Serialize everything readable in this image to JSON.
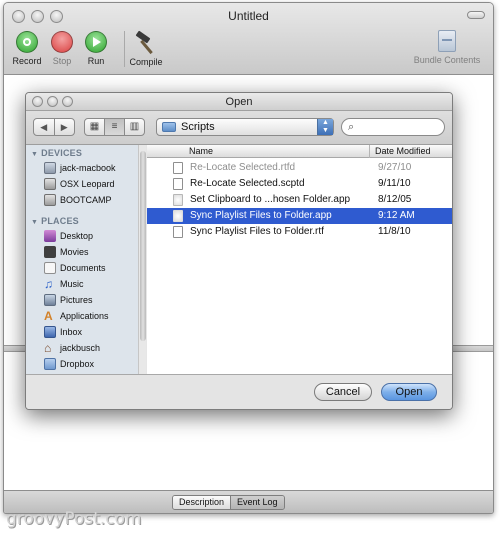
{
  "window": {
    "title": "Untitled"
  },
  "toolbar": {
    "record": "Record",
    "stop": "Stop",
    "run": "Run",
    "compile": "Compile",
    "bundle_contents": "Bundle Contents"
  },
  "bottom_tabs": [
    "Description",
    "Event Log"
  ],
  "dialog": {
    "title": "Open",
    "location": "Scripts",
    "search_placeholder": "",
    "sidebar": {
      "devices_header": "DEVICES",
      "devices": [
        "jack-macbook",
        "OSX Leopard",
        "BOOTCAMP"
      ],
      "places_header": "PLACES",
      "places": [
        "Desktop",
        "Movies",
        "Documents",
        "Music",
        "Pictures",
        "Applications",
        "Inbox",
        "jackbusch",
        "Dropbox"
      ]
    },
    "columns": {
      "name": "Name",
      "date": "Date Modified"
    },
    "files": [
      {
        "name": "Re-Locate Selected.rtfd",
        "date": "9/27/10"
      },
      {
        "name": "Re-Locate Selected.scptd",
        "date": "9/11/10"
      },
      {
        "name": "Set Clipboard to ...hosen Folder.app",
        "date": "8/12/05"
      },
      {
        "name": "Sync Playlist Files to Folder.app",
        "date": "9:12 AM"
      },
      {
        "name": "Sync Playlist Files to Folder.rtf",
        "date": "11/8/10"
      }
    ],
    "cancel": "Cancel",
    "open": "Open"
  },
  "watermark": "groovyPost.com"
}
